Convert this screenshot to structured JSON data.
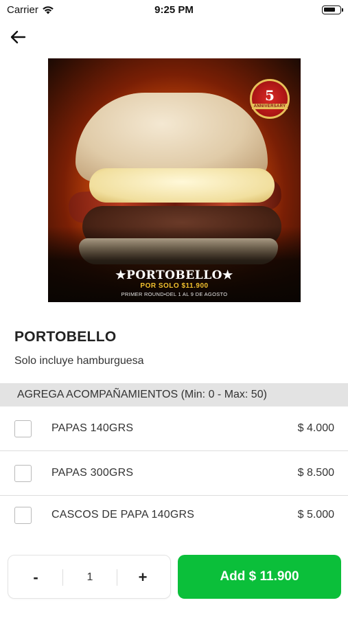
{
  "status_bar": {
    "carrier": "Carrier",
    "time": "9:25 PM"
  },
  "hero": {
    "title": "★PORTOBELLO★",
    "subtitle": "POR SOLO $11.900",
    "dates": "PRIMER ROUND•DEL 1 AL 9 DE AGOSTO",
    "badge_number": "5",
    "badge_text": "ANNIVERSARY"
  },
  "product": {
    "name": "PORTOBELLO",
    "description": "Solo incluye hamburguesa"
  },
  "section": {
    "title": "AGREGA ACOMPAÑAMIENTOS (Min: 0 - Max: 50)"
  },
  "options": [
    {
      "label": "PAPAS 140GRS",
      "price": "$ 4.000",
      "checked": false
    },
    {
      "label": "PAPAS 300GRS",
      "price": "$ 8.500",
      "checked": false
    },
    {
      "label": "CASCOS DE PAPA 140GRS",
      "price": "$ 5.000",
      "checked": false
    }
  ],
  "quantity": {
    "minus": "-",
    "value": "1",
    "plus": "+"
  },
  "add_button": {
    "label": "Add $ 11.900"
  },
  "colors": {
    "accent_green": "#0bbf3a",
    "section_bg": "#e3e3e3"
  }
}
